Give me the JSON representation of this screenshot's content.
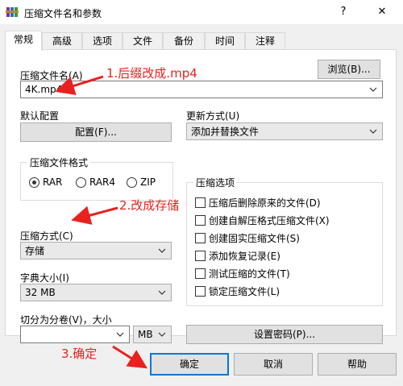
{
  "window": {
    "title": "压缩文件名和参数",
    "help_button": "?",
    "close_button": "✕"
  },
  "tabs": [
    "常规",
    "高级",
    "选项",
    "文件",
    "备份",
    "时间",
    "注释"
  ],
  "general": {
    "archive_name_label": "压缩文件名(A)",
    "browse_button": "浏览(B)...",
    "archive_name_value": "4K.mp4",
    "default_profile_label": "默认配置",
    "profile_button": "配置(F)...",
    "update_mode_label": "更新方式(U)",
    "update_mode_value": "添加并替换文件",
    "archive_format": {
      "legend": "压缩文件格式",
      "options": [
        "RAR",
        "RAR4",
        "ZIP"
      ],
      "selected": "RAR"
    },
    "compression_method_label": "压缩方式(C)",
    "compression_method_value": "存储",
    "dictionary_size_label": "字典大小(I)",
    "dictionary_size_value": "32 MB",
    "split_volumes_label": "切分为分卷(V)，大小",
    "split_volumes_value": "",
    "split_unit_value": "MB",
    "set_password_button": "设置密码(P)...",
    "archiving_options": {
      "legend": "压缩选项",
      "items": [
        "压缩后删除原来的文件(D)",
        "创建自解压格式压缩文件(X)",
        "创建固实压缩文件(S)",
        "添加恢复记录(E)",
        "测试压缩的文件(T)",
        "锁定压缩文件(L)"
      ]
    }
  },
  "footer": {
    "ok_button": "确定",
    "cancel_button": "取消",
    "help_button": "帮助"
  },
  "annotations": {
    "step1": "1.后缀改成.mp4",
    "step2": "2.改成存储",
    "step3": "3.确定"
  },
  "colors": {
    "annotation": "#e8211f",
    "default_button_border": "#0078d7"
  }
}
